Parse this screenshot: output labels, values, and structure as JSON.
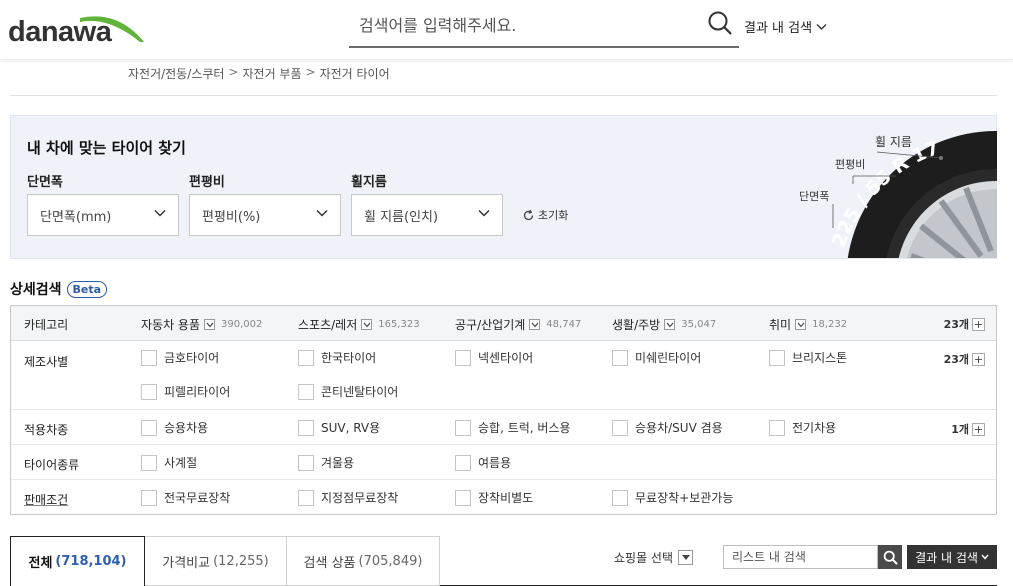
{
  "header": {
    "logo": "danawa",
    "search_placeholder": "검색어를 입력해주세요.",
    "result_search_label": "결과 내 검색"
  },
  "breadcrumb": [
    "자전거/전동/스쿠터",
    "자전거 부품",
    "자전거 타이어"
  ],
  "breadcrumb_sep": ">",
  "tire_finder": {
    "title": "내 차에 맞는 타이어 찾기",
    "fields": [
      {
        "label": "단면폭",
        "placeholder": "단면폭(mm)"
      },
      {
        "label": "편평비",
        "placeholder": "편평비(%)"
      },
      {
        "label": "휠지름",
        "placeholder": "휠 지름(인치)"
      }
    ],
    "reset_label": "초기화",
    "illustration": {
      "tire_text": "225 / 55 R 17",
      "callouts": [
        "휠 지름",
        "편평비",
        "단면폭"
      ]
    }
  },
  "detail_search": {
    "title": "상세검색",
    "badge": "Beta",
    "category_label": "카테고리",
    "categories": [
      {
        "name": "자동차 용품",
        "count": "390,002"
      },
      {
        "name": "스포츠/레저",
        "count": "165,323"
      },
      {
        "name": "공구/산업기계",
        "count": "48,747"
      },
      {
        "name": "생활/주방",
        "count": "35,047"
      },
      {
        "name": "취미",
        "count": "18,232"
      }
    ],
    "category_total": "23개",
    "rows": [
      {
        "label": "제조사별",
        "count": "23개",
        "options": [
          "금호타이어",
          "한국타이어",
          "넥센타이어",
          "미쉐린타이어",
          "브리지스톤",
          "피렐리타이어",
          "콘티넨탈타이어"
        ]
      },
      {
        "label": "적용차종",
        "count": "1개",
        "options": [
          "승용차용",
          "SUV, RV용",
          "승합, 트럭, 버스용",
          "승용차/SUV 겸용",
          "전기차용"
        ]
      },
      {
        "label": "타이어종류",
        "options": [
          "사계절",
          "겨울용",
          "여름용"
        ]
      },
      {
        "label": "판매조건",
        "options": [
          "전국무료장착",
          "지정점무료장착",
          "장착비별도",
          "무료장착+보관가능"
        ]
      }
    ]
  },
  "tabs": [
    {
      "label": "전체",
      "count": "(718,104)"
    },
    {
      "label": "가격비교",
      "count": "(12,255)"
    },
    {
      "label": "검색 상품",
      "count": "(705,849)"
    }
  ],
  "list_controls": {
    "mall_select_label": "쇼핑몰 선택",
    "list_search_placeholder": "리스트 내 검색",
    "result_search_label": "결과 내 검색"
  },
  "colors": {
    "accent_blue": "#2e5fb5",
    "logo_green": "#5fb43a",
    "finder_bg": "#eff2f8"
  }
}
